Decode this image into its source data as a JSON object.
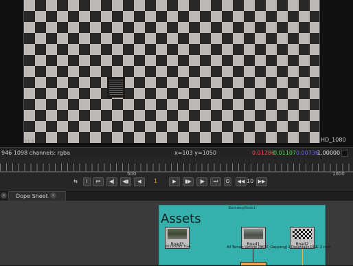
{
  "viewer": {
    "format_label": "HD_1080",
    "bbox_label": "11,3"
  },
  "infobar": {
    "size_channels": "946 1098 channels: rgba",
    "coords": "x=103 y=1050",
    "red": "0.01286",
    "green": "0.01107",
    "blue": "0.00736",
    "alpha": "1.00000"
  },
  "timeline": {
    "tick_500": "500",
    "tick_1000": "1000",
    "current_frame": "1",
    "increment": "10",
    "colors": {
      "frame": "#f0a02c"
    }
  },
  "tabs": [
    {
      "label": "Dope Sheet"
    }
  ],
  "nodegraph": {
    "backdrop_title": "BackdropNode1",
    "backdrop_label": "Assets",
    "backdrop_color": "#35b0ad",
    "nodes": [
      {
        "label": "Road3",
        "sublabel": "20190285.TGA"
      },
      {
        "label": "Road1",
        "sublabel": "All Terrain Vehicle  (BK3C_Gauyang) 2DC...ene DGR..."
      },
      {
        "label": "Road2",
        "sublabel": "Dieleniaus DGR..2 mov"
      }
    ]
  }
}
